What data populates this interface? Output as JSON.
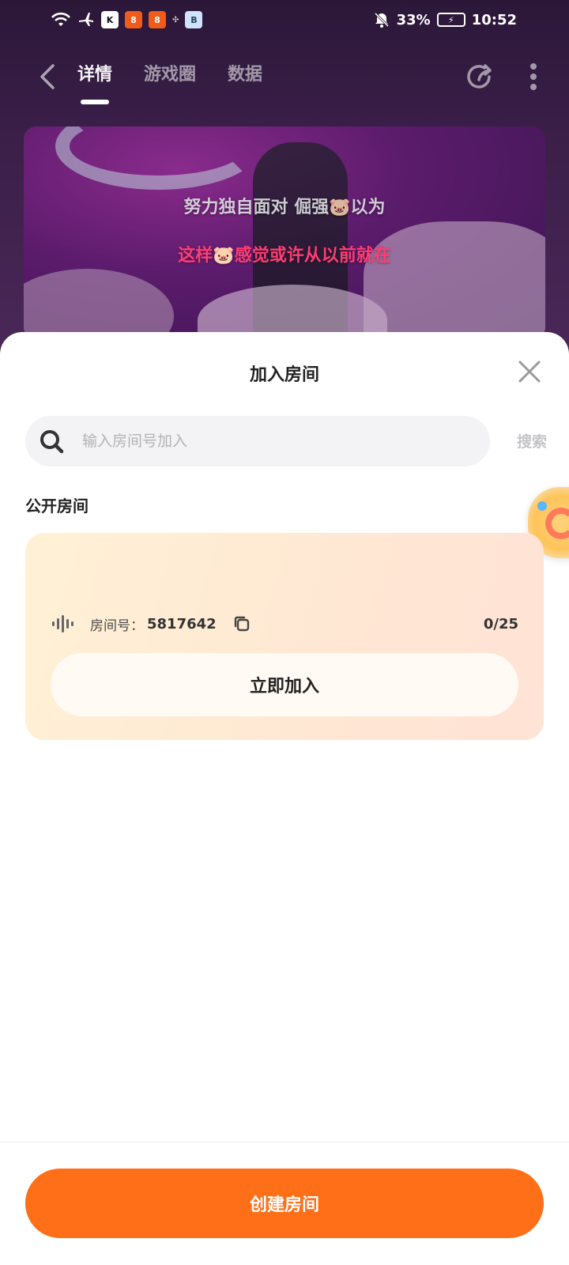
{
  "status_bar": {
    "app_icons": [
      "K",
      "8",
      "8",
      "B"
    ],
    "battery_percent": "33%",
    "time": "10:52"
  },
  "nav": {
    "tabs": [
      {
        "label": "详情",
        "active": true
      },
      {
        "label": "游戏圈",
        "active": false
      },
      {
        "label": "数据",
        "active": false
      }
    ]
  },
  "video": {
    "lyric_line_1": "努力独自面对  倔强🐷以为",
    "lyric_line_2": "这样🐷感觉或许从以前就在"
  },
  "sheet": {
    "title": "加入房间",
    "search": {
      "placeholder": "输入房间号加入",
      "value": "",
      "button_label": "搜索"
    },
    "section_title": "公开房间",
    "rooms": [
      {
        "room_label": "房间号：",
        "room_number": "5817642",
        "count": "0/25",
        "join_label": "立即加入"
      }
    ],
    "create_label": "创建房间"
  },
  "colors": {
    "accent": "#ff6f18",
    "lyric_highlight": "#ff3d73",
    "sheet_bg": "#ffffff",
    "search_bg": "#f3f3f5",
    "card_gradient_start": "#fff1d6",
    "card_gradient_end": "#ffe3d6"
  },
  "icons": {
    "status": [
      "wifi-icon",
      "airplane-icon",
      "bell-off-icon",
      "battery-charging-icon"
    ],
    "nav": [
      "back-icon",
      "share-icon",
      "more-icon"
    ],
    "sheet": [
      "close-icon",
      "search-icon",
      "audio-wave-icon",
      "copy-icon"
    ]
  }
}
